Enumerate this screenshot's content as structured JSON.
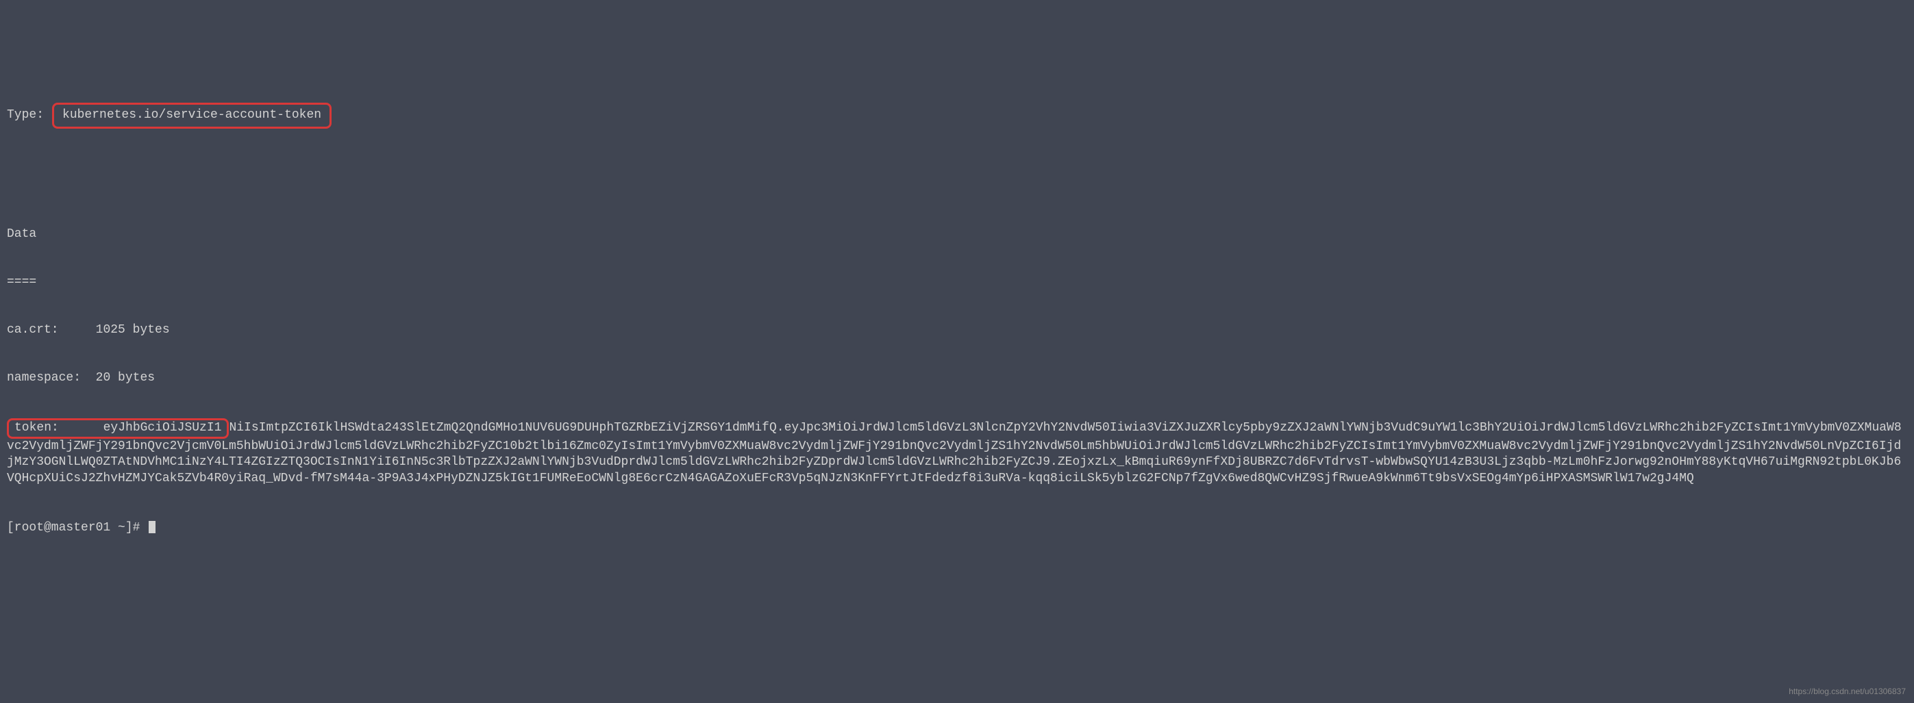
{
  "type_label": "Type:",
  "type_value": "kubernetes.io/service-account-token",
  "data_header": "Data",
  "data_separator": "====",
  "ca_crt": {
    "label": "ca.crt:",
    "value": "1025 bytes"
  },
  "namespace": {
    "label": "namespace:",
    "value": "20 bytes"
  },
  "token": {
    "label": "token:",
    "label_boxed_part": "eyJhbGciOiJSUzI1",
    "value_rest": "NiIsImtpZCI6IklHSWdta243SlEtZmQ2QndGMHo1NUV6UG9DUHphTGZRbEZiVjZRSGY1dmMifQ.eyJpc3MiOiJrdWJlcm5ldGVzL3NlcnZpY2VhY2NvdW50Iiwia3ViZXJuZXRlcy5pby9zZXJ2aWNlYWNjb3VudC9uYW1lc3BhY2UiOiJrdWJlcm5ldGVzLWRhc2hib2FyZCIsImt1YmVybmV0ZXMuaW8vc2VydmljZWFjY291bnQvc2VjcmV0Lm5hbWUiOiJrdWJlcm5ldGVzLWRhc2hib2FyZC10b2tlbi16Zmc0ZyIsImt1YmVybmV0ZXMuaW8vc2VydmljZWFjY291bnQvc2VydmljZS1hY2NvdW50Lm5hbWUiOiJrdWJlcm5ldGVzLWRhc2hib2FyZCIsImt1YmVybmV0ZXMuaW8vc2VydmljZWFjY291bnQvc2VydmljZS1hY2NvdW50LnVpZCI6IjdjMzY3OGNlLWQ0ZTAtNDVhMC1iNzY4LTI4ZGIzZTQ3OCIsInN1YiI6InN5c3RlbTpzZXJ2aWNlYWNjb3VudDprdWJlcm5ldGVzLWRhc2hib2FyZDprdWJlcm5ldGVzLWRhc2hib2FyZCJ9.ZEojxzLx_kBmqiuR69ynFfXDj8UBRZC7d6FvTdrvsT-wbWbwSQYU14zB3U3Ljz3qbb-MzLm0hFzJorwg92nOHmY88yKtqVH67uiMgRN92tpbL0KJb6VQHcpXUiCsJ2ZhvHZMJYCak5ZVb4R0yiRaq_WDvd-fM7sM44a-3P9A3J4xPHyDZNJZ5kIGt1FUMReEoCWNlg8E6crCzN4GAGAZoXuEFcR3Vp5qNJzN3KnFFYrtJtFdedzf8i3uRVa-kqq8iciLSk5yblzG2FCNp7fZgVx6wed8QWCvHZ9SjfRwueA9kWnm6Tt9bsVxSEOg4mYp6iHPXASMSWRlW17w2gJ4MQ"
  },
  "prompt": "[root@master01 ~]#",
  "watermark": "https://blog.csdn.net/u01306837"
}
